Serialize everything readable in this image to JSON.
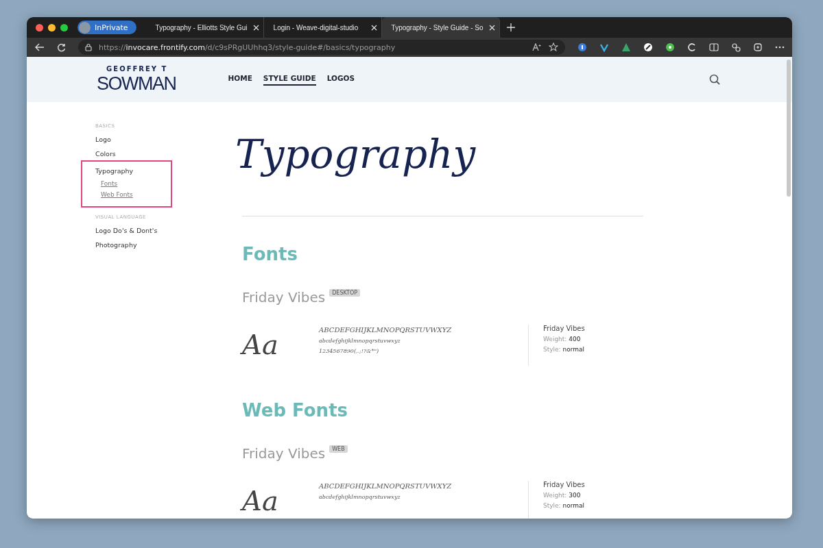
{
  "browser": {
    "profile": "InPrivate",
    "tabs": [
      {
        "title": "Typography - Elliotts Style Gui",
        "selected": false
      },
      {
        "title": "Login - Weave-digital-studio",
        "selected": false
      },
      {
        "title": "Typography - Style Guide - So",
        "selected": true
      }
    ],
    "url": {
      "scheme": "https://",
      "host": "invocare.frontify.com",
      "path": "/d/c9sPRgUUhhq3/style-guide#/basics/typography"
    }
  },
  "site": {
    "logo_top": "GEOFFREY T",
    "logo_bottom": "SOWMAN",
    "nav": [
      {
        "label": "HOME",
        "selected": false
      },
      {
        "label": "STYLE GUIDE",
        "selected": true
      },
      {
        "label": "LOGOS",
        "selected": false
      }
    ]
  },
  "sidebar": {
    "sections": [
      {
        "heading": "BASICS",
        "items": [
          {
            "label": "Logo",
            "highlighted": false
          },
          {
            "label": "Colors",
            "highlighted": false
          },
          {
            "label": "Typography",
            "highlighted": true,
            "children": [
              {
                "label": "Fonts"
              },
              {
                "label": "Web Fonts"
              }
            ]
          }
        ]
      },
      {
        "heading": "VISUAL LANGUAGE",
        "items": [
          {
            "label": "Logo Do's & Dont's",
            "highlighted": false
          },
          {
            "label": "Photography",
            "highlighted": false
          }
        ]
      }
    ]
  },
  "main": {
    "title": "Typography",
    "sections": [
      {
        "heading": "Fonts",
        "font": {
          "name": "Friday Vibes",
          "badge": "DESKTOP",
          "sample": "Aa",
          "lines": [
            "ABCDEFGHIJKLMNOPQRSTUVWXYZ",
            "abcdefghijklmnopqrstuvwxyz",
            "1234567890(,.;!?&*\")"
          ],
          "info_name": "Friday Vibes",
          "weight_label": "Weight:",
          "weight": "400",
          "style_label": "Style:",
          "style": "normal"
        }
      },
      {
        "heading": "Web Fonts",
        "font": {
          "name": "Friday Vibes",
          "badge": "WEB",
          "sample": "Aa",
          "lines": [
            "ABCDEFGHIJKLMNOPQRSTUVWXYZ",
            "abcdefghijklmnopqrstuvwxyz"
          ],
          "info_name": "Friday Vibes",
          "weight_label": "Weight:",
          "weight": "300",
          "style_label": "Style:",
          "style": "normal"
        }
      }
    ]
  }
}
